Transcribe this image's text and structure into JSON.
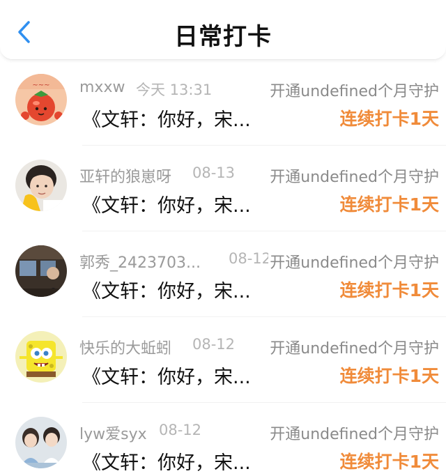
{
  "header": {
    "title": "日常打卡",
    "back_icon": "chevron-left-icon",
    "accent_color": "#2f8ff0"
  },
  "entries": [
    {
      "name": "mxxw",
      "time": "今天 13:31",
      "subscription": "开通undefined个月守护",
      "message": "《文轩：你好，宋...",
      "streak": "连续打卡1天",
      "avatar": "tomato-cartoon-avatar"
    },
    {
      "name": "亚轩的狼崽呀",
      "time": "08-13",
      "subscription": "开通undefined个月守护",
      "message": "《文轩：你好，宋...",
      "streak": "连续打卡1天",
      "avatar": "child-photo-avatar"
    },
    {
      "name": "郭秀_2423703...",
      "time": "08-12",
      "subscription": "开通undefined个月守护",
      "message": "《文轩：你好，宋...",
      "streak": "连续打卡1天",
      "avatar": "dark-photo-avatar"
    },
    {
      "name": "快乐的大蚯蚓",
      "time": "08-12",
      "subscription": "开通undefined个月守护",
      "message": "《文轩：你好，宋...",
      "streak": "连续打卡1天",
      "avatar": "spongebob-avatar"
    },
    {
      "name": "lyw爱syx",
      "time": "08-12",
      "subscription": "开通undefined个月守护",
      "message": "《文轩：你好，宋...",
      "streak": "连续打卡1天",
      "avatar": "two-people-photo-avatar"
    }
  ]
}
